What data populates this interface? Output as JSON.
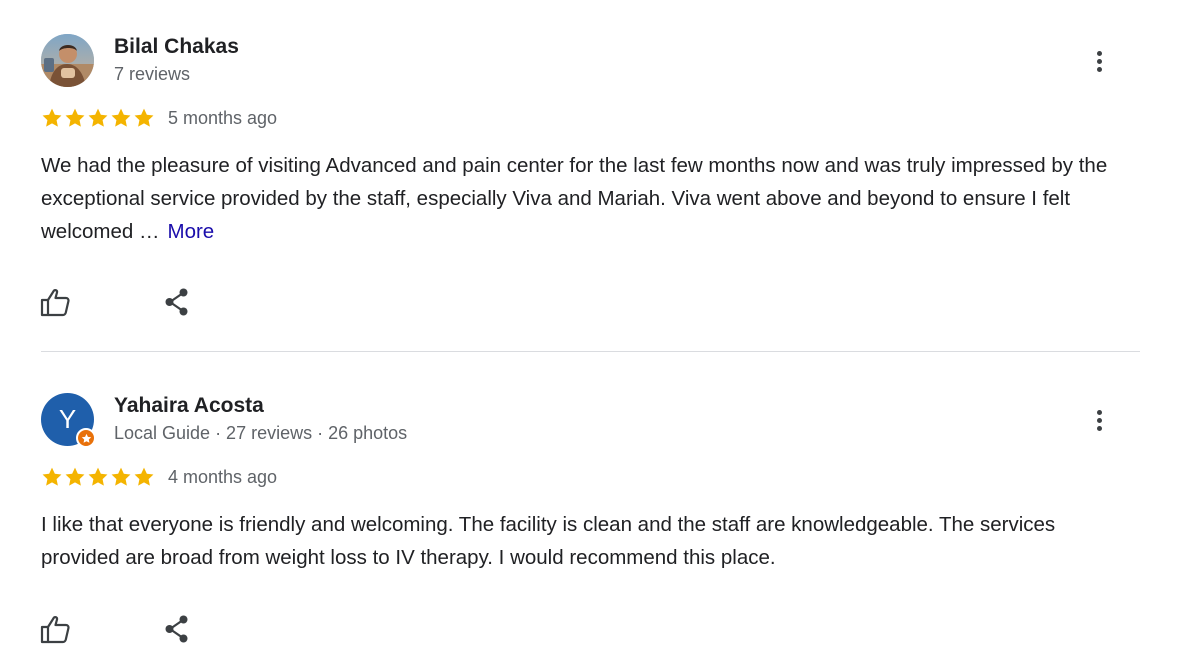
{
  "colors": {
    "star": "#f4b400",
    "link": "#1a0dab",
    "meta_text": "#5f6368",
    "body_text": "#202124",
    "divider": "#dadce0",
    "avatar_blue": "#1f5fab",
    "local_guide_badge": "#e8710a"
  },
  "icons": {
    "menu": "more-vertical-icon",
    "like": "thumb-up-icon",
    "share": "share-icon",
    "star": "star-icon",
    "badge": "local-guide-star-icon"
  },
  "reviews": [
    {
      "author": "Bilal Chakas",
      "meta": "7 reviews",
      "avatar_type": "photo",
      "rating": 5,
      "date": "5 months ago",
      "text": "We had the pleasure of visiting Advanced and pain center for the last few months now and was truly impressed by the exceptional service provided by the staff, especially Viva and Mariah. Viva went above and beyond to ensure I felt welcomed …",
      "more_label": "More"
    },
    {
      "author": "Yahaira Acosta",
      "meta": "Local Guide · 27 reviews · 26 photos",
      "avatar_type": "letter",
      "avatar_letter": "Y",
      "rating": 5,
      "date": "4 months ago",
      "text": "I like that everyone is friendly and welcoming. The facility is clean and the staff are knowledgeable. The services provided are broad from weight loss to IV therapy. I would recommend this place."
    }
  ]
}
